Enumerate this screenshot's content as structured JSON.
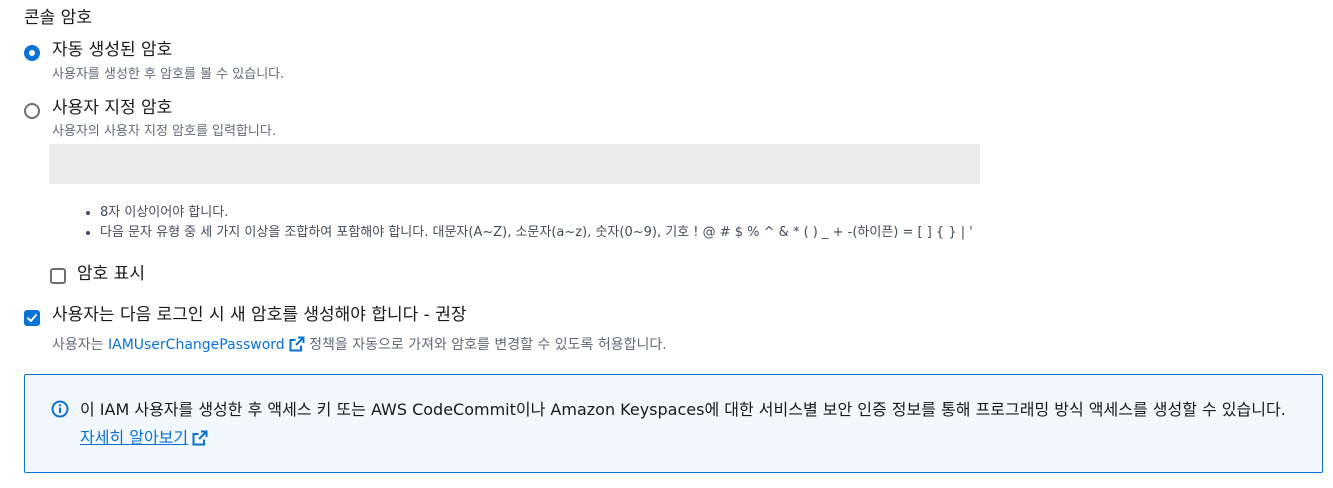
{
  "console_password": {
    "section_title": "콘솔 암호",
    "options": [
      {
        "label": "자동 생성된 암호",
        "description": "사용자를 생성한 후 암호를 볼 수 있습니다.",
        "selected": true
      },
      {
        "label": "사용자 지정 암호",
        "description": "사용자의 사용자 지정 암호를 입력합니다.",
        "selected": false
      }
    ],
    "custom_password_input": {
      "value": "",
      "placeholder": ""
    },
    "requirements": [
      "8자 이상이어야 합니다.",
      "다음 문자 유형 중 세 가지 이상을 조합하여 포함해야 합니다. 대문자(A~Z), 소문자(a~z), 숫자(0~9), 기호 ! @ # $ % ^ & * ( ) _ + -(하이픈) = [ ] { } | '"
    ],
    "show_password": {
      "label": "암호 표시",
      "checked": false
    },
    "require_reset": {
      "label": "사용자는 다음 로그인 시 새 암호를 생성해야 합니다 - 권장",
      "checked": true,
      "description_prefix": "사용자는 ",
      "policy_link": "IAMUserChangePassword",
      "description_suffix": " 정책을 자동으로 가져와 암호를 변경할 수 있도록 허용합니다."
    }
  },
  "info_alert": {
    "text": "이 IAM 사용자를 생성한 후 액세스 키 또는 AWS CodeCommit이나 Amazon Keyspaces에 대한 서비스별 보안 인증 정보를 통해 프로그래밍 방식 액세스를 생성할 수 있습니다. ",
    "link": "자세히 알아보기"
  },
  "icons": {
    "selected_radio": "radio-selected-icon",
    "unselected_radio": "radio-unselected-icon",
    "external_link": "external-link-icon",
    "info": "info-icon",
    "check": "checkmark-icon"
  },
  "colors": {
    "accent": "#0972d3",
    "info_background": "#f2f8fd",
    "input_disabled_background": "#e9ebed",
    "muted_text": "#5f6b7a"
  }
}
